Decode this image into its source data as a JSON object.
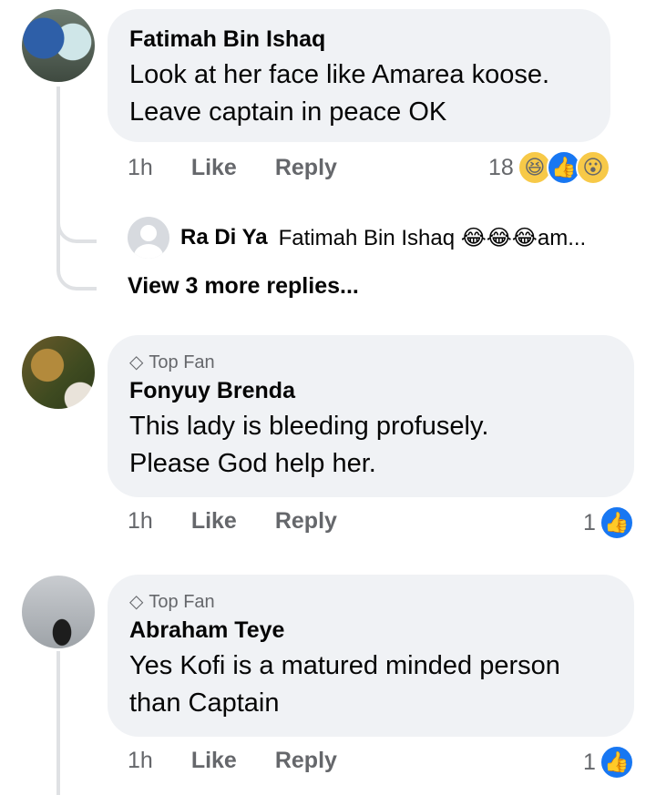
{
  "comments": [
    {
      "author": "Fatimah Bin Ishaq",
      "text_lines": [
        "Look at her face like Amarea koose.",
        "Leave captain in peace OK"
      ],
      "time": "1h",
      "like_label": "Like",
      "reply_label": "Reply",
      "reaction_count": "18",
      "reactions": [
        "laugh-icon",
        "like-icon",
        "wow-icon"
      ],
      "reply": {
        "author": "Ra Di Ya",
        "text": "Fatimah Bin Ishaq 😂😂😂am..."
      },
      "view_more": "View 3 more replies..."
    },
    {
      "badge": "Top Fan",
      "author": "Fonyuy Brenda",
      "text_lines": [
        "This lady is bleeding profusely.",
        "Please God help her."
      ],
      "time": "1h",
      "like_label": "Like",
      "reply_label": "Reply",
      "reaction_count": "1",
      "reactions": [
        "like-icon"
      ]
    },
    {
      "badge": "Top Fan",
      "author": "Abraham Teye",
      "text_lines": [
        "Yes Kofi is a matured minded person",
        "than Captain"
      ],
      "time": "1h",
      "like_label": "Like",
      "reply_label": "Reply",
      "reaction_count": "1",
      "reactions": [
        "like-icon"
      ]
    }
  ],
  "colors": {
    "bubble": "#f0f2f5",
    "meta_text": "#65676b",
    "like_blue": "#1877f2"
  }
}
